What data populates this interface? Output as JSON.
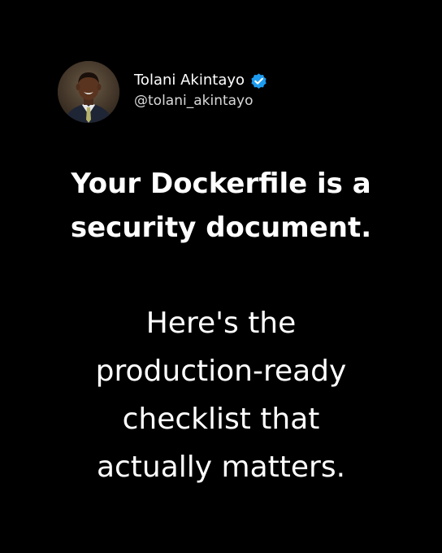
{
  "author": {
    "name": "Tolani Akintayo",
    "handle": "@tolani_akintayo",
    "verified": true,
    "avatar_icon": "profile-photo",
    "verified_icon": "verified-badge-icon"
  },
  "headline": {
    "lines": [
      "Your Dockerfile is a",
      "security document."
    ]
  },
  "body": {
    "lines": [
      "Here's the",
      "production-ready",
      "checklist that",
      "actually matters."
    ]
  },
  "colors": {
    "background": "#000000",
    "text": "#ffffff",
    "verified_badge": "#1d9bf0"
  }
}
